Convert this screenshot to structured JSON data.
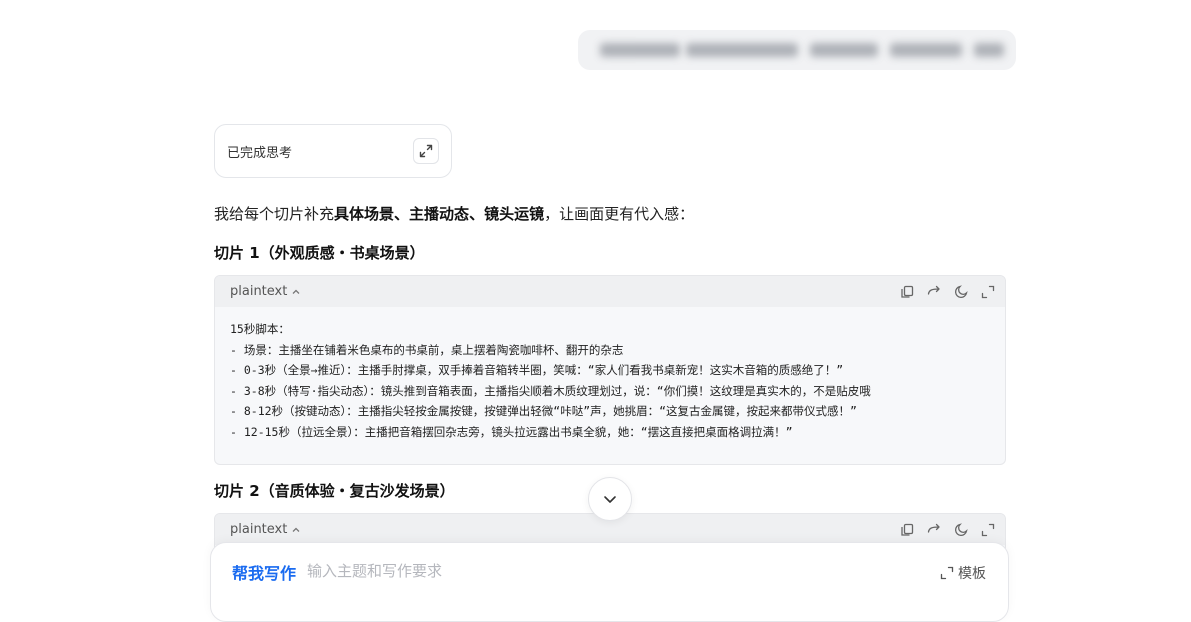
{
  "thinking": {
    "label": "已完成思考"
  },
  "intro": {
    "prefix": "我给每个切片补充",
    "bold1": "具体场景",
    "sep1": "、",
    "bold2": "主播动态",
    "sep2": "、",
    "bold3": "镜头运镜",
    "suffix": "，让画面更有代入感："
  },
  "slices": [
    {
      "title": "切片 1（外观质感・书桌场景）",
      "lang": "plaintext",
      "lines": [
        "15秒脚本：",
        "- 场景：主播坐在铺着米色桌布的书桌前，桌上摆着陶瓷咖啡杯、翻开的杂志",
        "- 0-3秒（全景→推近）：主播手肘撑桌，双手捧着音箱转半圈，笑喊：“家人们看我书桌新宠！这实木音箱的质感绝了！”",
        "- 3-8秒（特写·指尖动态）：镜头推到音箱表面，主播指尖顺着木质纹理划过，说：“你们摸！这纹理是真实木的，不是贴皮哦",
        "- 8-12秒（按键动态）：主播指尖轻按金属按键，按键弹出轻微“咔哒”声，她挑眉：“这复古金属键，按起来都带仪式感！”",
        "- 12-15秒（拉远全景）：主播把音箱摆回杂志旁，镜头拉远露出书桌全貌，她：“摆这直接把桌面格调拉满！”"
      ]
    },
    {
      "title": "切片 2（音质体验・复古沙发场景）",
      "lang": "plaintext",
      "lines": []
    }
  ],
  "composer": {
    "mode_label": "帮我写作",
    "placeholder": "输入主题和写作要求",
    "template_label": "模板"
  },
  "colors": {
    "accent": "#1a6bf0"
  }
}
